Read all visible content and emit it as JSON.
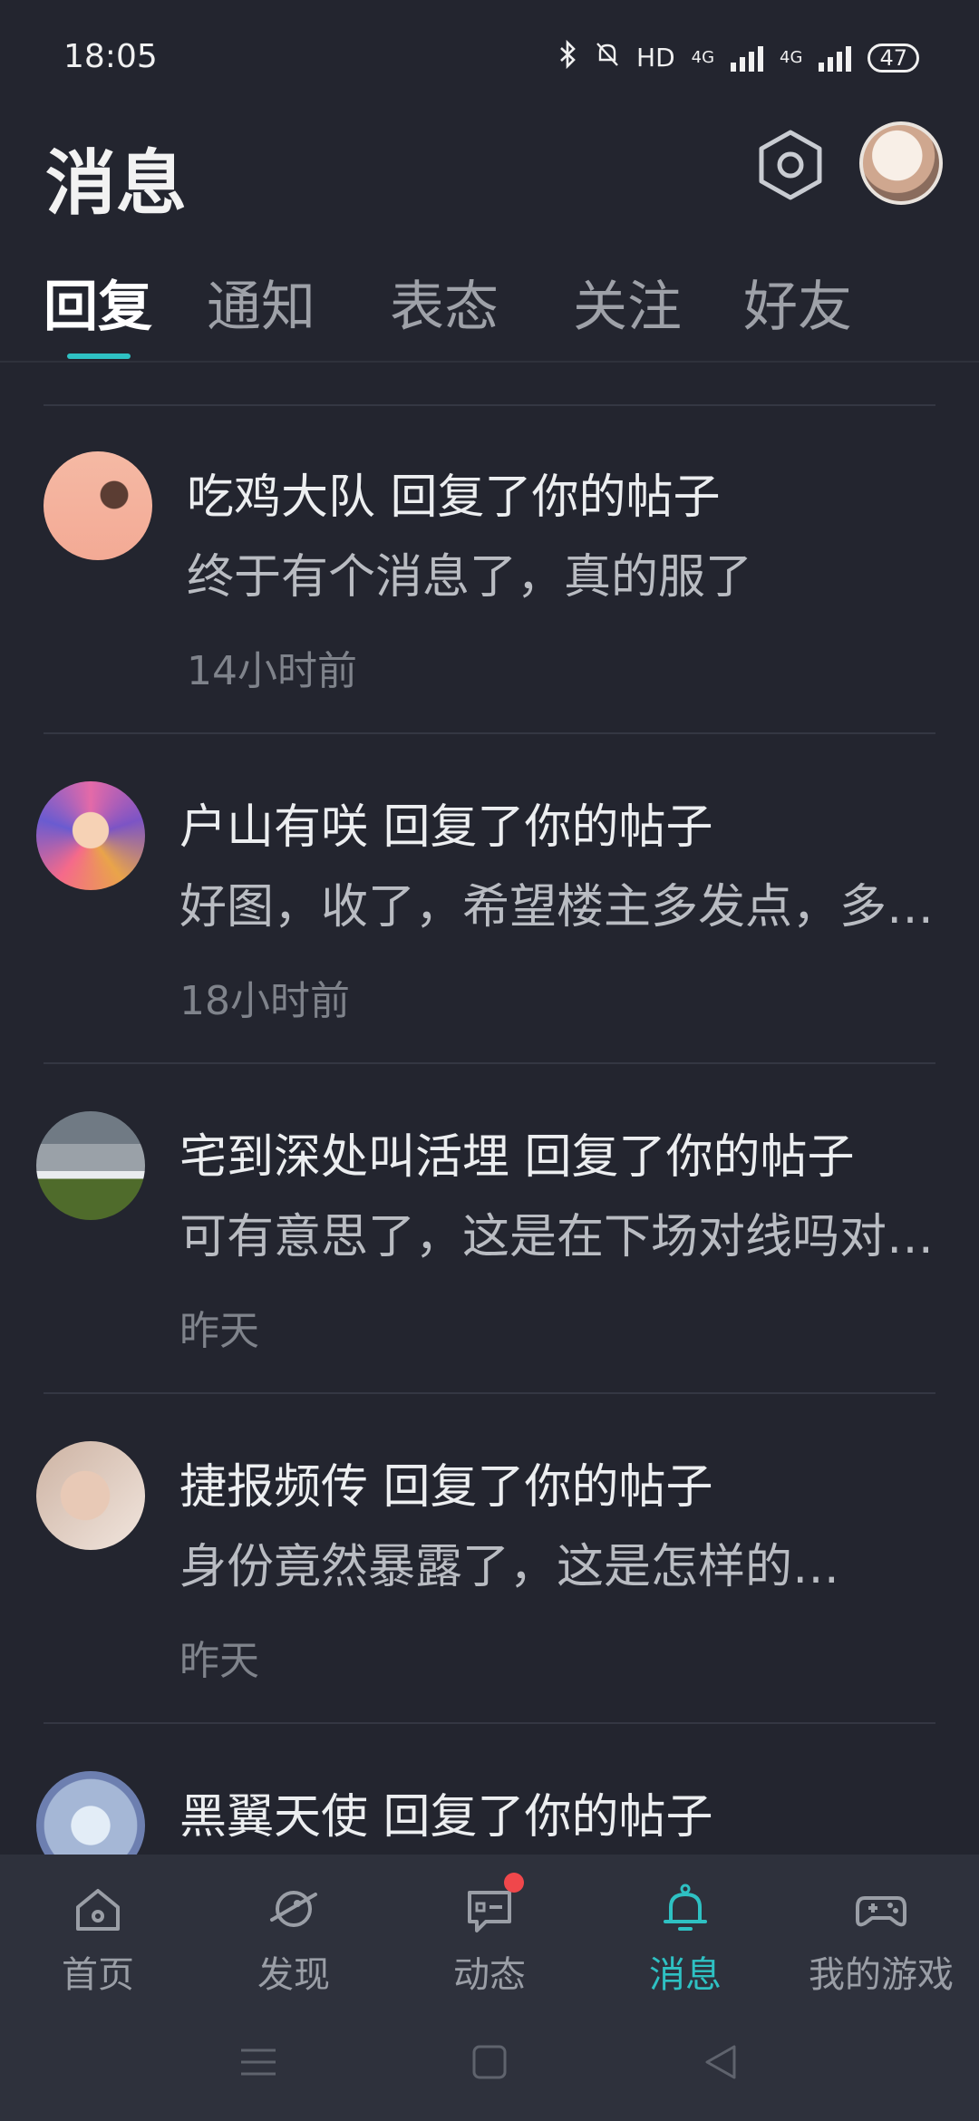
{
  "status_bar": {
    "time": "18:05",
    "hd": "HD",
    "net1": "4G",
    "net2": "4G",
    "battery": "47"
  },
  "header": {
    "title": "消息",
    "settings_icon": "hexagon-settings-icon",
    "avatar_icon": "profile-avatar"
  },
  "tabs": [
    {
      "label": "回复",
      "active": true
    },
    {
      "label": "通知"
    },
    {
      "label": "表态"
    },
    {
      "label": "关注"
    },
    {
      "label": "好友"
    }
  ],
  "messages": [
    {
      "title": "吃鸡大队 回复了你的帖子",
      "body": "终于有个消息了，真的服了",
      "time": "14小时前"
    },
    {
      "title": "户山有咲 回复了你的帖子",
      "body": "好图，收了，希望楼主多发点，多发点",
      "time": "18小时前"
    },
    {
      "title": "宅到深处叫活埋 回复了你的帖子",
      "body": "可有意思了，这是在下场对线吗对线吗",
      "time": "昨天"
    },
    {
      "title": "捷报频传 回复了你的帖子",
      "body": "身份竟然暴露了，这是怎样的…",
      "time": "昨天"
    },
    {
      "title": "黑翼天使 回复了你的帖子",
      "body": "",
      "time": ""
    }
  ],
  "bottom_nav": [
    {
      "label": "首页",
      "icon": "home-icon"
    },
    {
      "label": "发现",
      "icon": "planet-icon"
    },
    {
      "label": "动态",
      "icon": "chat-icon",
      "badge": true
    },
    {
      "label": "消息",
      "icon": "bell-icon",
      "active": true
    },
    {
      "label": "我的游戏",
      "icon": "gamepad-icon"
    }
  ],
  "colors": {
    "background": "#23252f",
    "accent": "#2ec1c3",
    "nav_bg": "#2e313c",
    "badge": "#f0474b"
  }
}
